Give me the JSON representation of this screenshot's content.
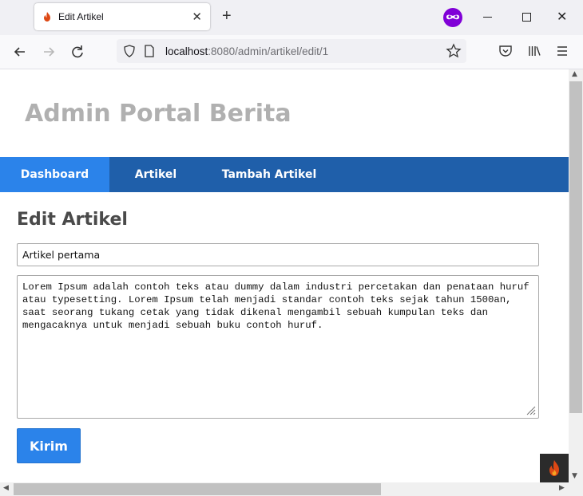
{
  "browser": {
    "tab_title": "Edit Artikel",
    "url_host": "localhost",
    "url_rest": ":8080/admin/artikel/edit/1"
  },
  "site": {
    "title": "Admin Portal Berita",
    "menu": [
      {
        "label": "Dashboard",
        "active": true
      },
      {
        "label": "Artikel",
        "active": false
      },
      {
        "label": "Tambah Artikel",
        "active": false
      }
    ]
  },
  "form": {
    "heading": "Edit Artikel",
    "title_value": "Artikel pertama",
    "body_value": "Lorem Ipsum adalah contoh teks atau dummy dalam industri percetakan dan penataan huruf atau typesetting. Lorem Ipsum telah menjadi standar contoh teks sejak tahun 1500an, saat seorang tukang cetak yang tidak dikenal mengambil sebuah kumpulan teks dan mengacaknya untuk menjadi sebuah buku contoh huruf.",
    "submit_label": "Kirim"
  },
  "colors": {
    "menu_bar": "#1f5faa",
    "menu_active": "#2b83ea",
    "button": "#2b83ea",
    "site_title": "#b0b0b0",
    "private_badge": "#8000d7"
  },
  "icons": [
    "codeigniter-flame-icon",
    "private-browsing-icon",
    "back-arrow-icon",
    "forward-arrow-icon",
    "reload-icon",
    "shield-icon",
    "page-icon",
    "star-icon",
    "pocket-icon",
    "library-icon",
    "hamburger-menu-icon"
  ]
}
